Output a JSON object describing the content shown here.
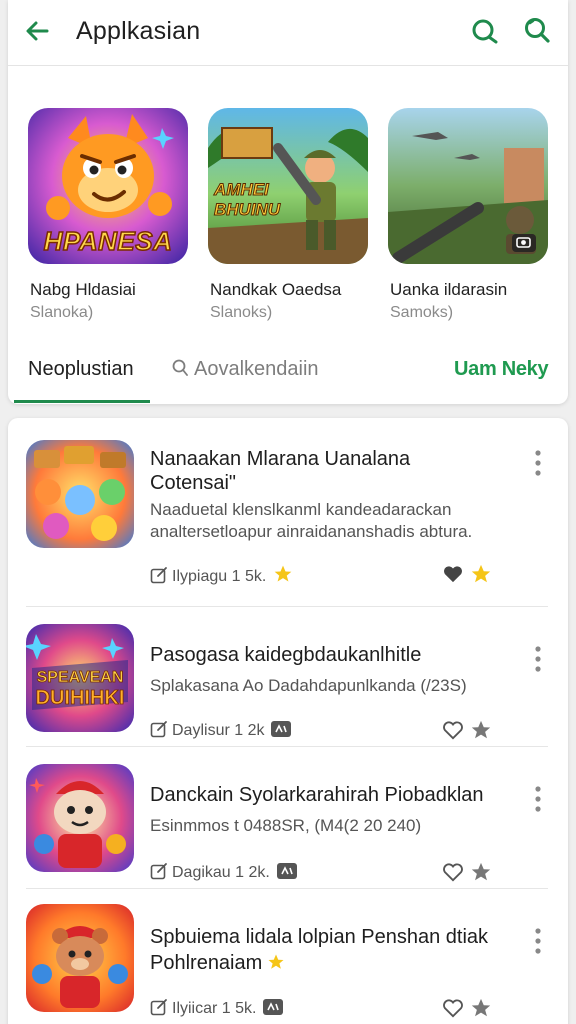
{
  "header": {
    "title": "Applkasian"
  },
  "featured": [
    {
      "art_text": "HPANESA",
      "name": "Nabg Hldasiai",
      "sub": "Slanoka)"
    },
    {
      "art_text": "AMHEI BHUINU",
      "name": "Nandkak Oaedsa",
      "sub": "Slanoks)"
    },
    {
      "art_text": "",
      "name": "Uanka ildarasin",
      "sub": "Samoks)"
    }
  ],
  "tabs": [
    {
      "label": "Neoplustian"
    },
    {
      "label": "Aovalkendaiin"
    },
    {
      "label": "Uam Neky"
    }
  ],
  "list": [
    {
      "title1": "Nanaakan Mlarana Uanalana",
      "title2": "Cotensai\"",
      "desc1": "Naaduetal klenslkanml kandeadarackan",
      "desc2": "analtersetloapur ainraidananshadis abtura.",
      "meta": "Ilypiagu 1 5k.",
      "liked": true,
      "starred": true
    },
    {
      "title1": "Pasogasa kaidegbdaukanlhitle",
      "desc1": "Splakasana Ao Dadahdapunlkanda (/23S)",
      "meta": "Daylisur 1 2k",
      "liked": false,
      "starred": false
    },
    {
      "title1": "Danckain Syolarkarahirah Piobadklan",
      "desc1": "Esinmmos t 0488SR, (M4(2 20 240)",
      "meta": "Dagikau 1 2k.",
      "liked": false,
      "starred": false
    },
    {
      "title1": "Spbuiema lidala lolpian Penshan dtiak",
      "title2": "Pohlrenaiam",
      "meta": "Ilyiicar 1 5k.",
      "liked": false,
      "starred": false
    }
  ],
  "colors": {
    "accent": "#1f8a4c",
    "star": "#f5c518"
  }
}
